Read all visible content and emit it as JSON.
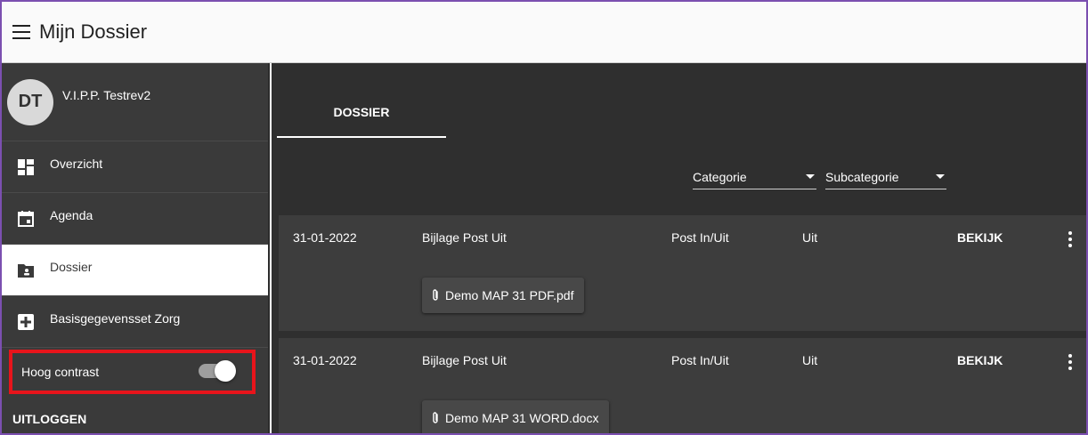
{
  "header": {
    "title": "Mijn Dossier"
  },
  "user": {
    "initials": "DT",
    "name": "V.I.P.P. Testrev2"
  },
  "sidebar": {
    "items": [
      {
        "label": "Overzicht"
      },
      {
        "label": "Agenda"
      },
      {
        "label": "Dossier"
      },
      {
        "label": "Basisgegevensset Zorg"
      }
    ],
    "high_contrast_label": "Hoog contrast",
    "logout_label": "UITLOGGEN"
  },
  "main": {
    "tab_label": "DOSSIER",
    "filters": {
      "category": "Categorie",
      "subcategory": "Subcategorie"
    },
    "rows": [
      {
        "date": "31-01-2022",
        "title": "Bijlage Post Uit",
        "type": "Post In/Uit",
        "direction": "Uit",
        "action": "BEKIJK",
        "attachment": "Demo MAP 31 PDF.pdf"
      },
      {
        "date": "31-01-2022",
        "title": "Bijlage Post Uit",
        "type": "Post In/Uit",
        "direction": "Uit",
        "action": "BEKIJK",
        "attachment": "Demo MAP 31 WORD.docx"
      }
    ]
  },
  "colors": {
    "sidebar_bg": "#3a3a3a",
    "main_bg": "#2f2f2f",
    "row_bg": "#3d3d3d",
    "highlight_border": "#e8141b",
    "frame_border": "#7b4fb0"
  }
}
